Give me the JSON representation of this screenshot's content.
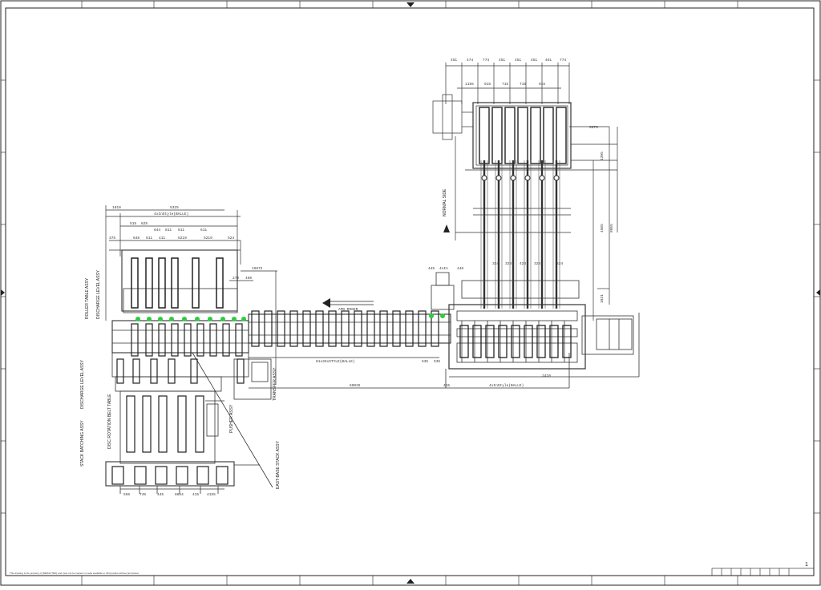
{
  "sheet": {
    "number": "1",
    "footer_note": "This drawing is the property of [REDACTED] and must not be copied or made available to third parties without permission"
  },
  "labels": {
    "flow_arrow": "APD ROGER",
    "side_main": "ROLLER TABLE ASSY",
    "side_disch_upper": "DISCHARGE LEVEL ASSY",
    "side_disch_lower": "DISCHARGE LEVEL ASSY",
    "side_transfer": "TRANSFER ASSY",
    "side_stack": "STACK BATCHING ASSY",
    "disc_table": "DISC ROTATION BELT TABLE",
    "pusher": "PUSHER ASSY",
    "vert_mid": "TRANSFER ASSY",
    "eas": "EAST-BASE STACK ASSY",
    "right_vertical": "NORMAL SIDE"
  },
  "dims": {
    "top_right": [
      "451",
      "474",
      "774",
      "451",
      "451",
      "451",
      "451",
      "774"
    ],
    "top_right_2": [
      "1155",
      "915",
      "715",
      "715",
      "915"
    ],
    "left_top": [
      "1810",
      "5325",
      "4xInStyle(BALLE)"
    ],
    "left_row2": [
      "515",
      "825",
      "644",
      "811",
      "611",
      "611"
    ],
    "left_row3": [
      "375",
      "648",
      "611",
      "411",
      "5219",
      "5219",
      "524"
    ],
    "mid": [
      "15872",
      "270",
      "450"
    ],
    "bottom_mid": [
      "61x33xSTYLE(BALLE)",
      "535",
      "535"
    ],
    "long": "60925",
    "bottom_right": [
      "415",
      "4xInStyle(BALLE)",
      "2410"
    ],
    "bottom_left": [
      "555",
      "745",
      "445",
      "8854",
      "415",
      "4155"
    ],
    "right_side": [
      "5575",
      "1395",
      "4505",
      "8955",
      "1921"
    ],
    "middle_right": [
      "445",
      "4xIn",
      "448",
      "324",
      "324",
      "424",
      "324",
      "524"
    ]
  }
}
